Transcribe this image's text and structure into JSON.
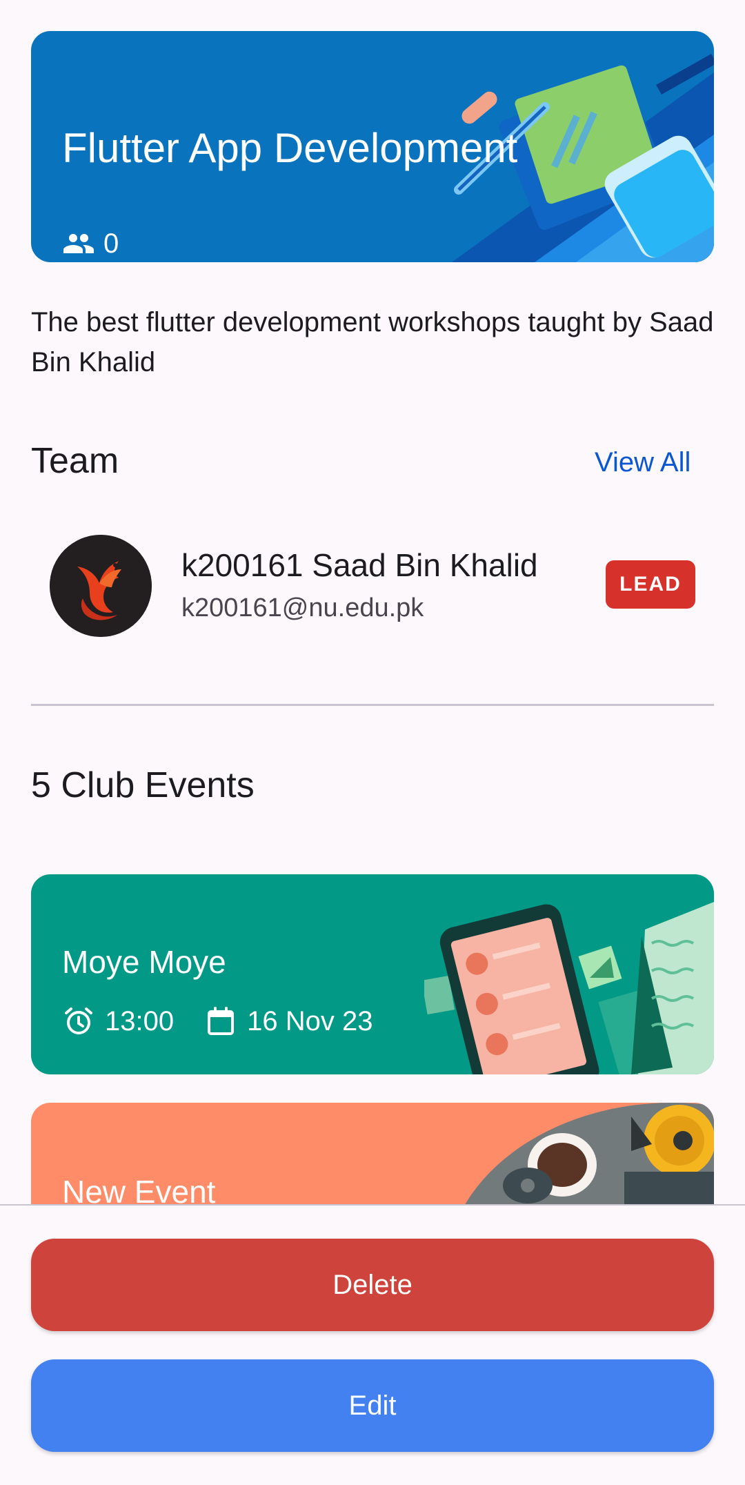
{
  "club": {
    "title": "Flutter App Development",
    "member_count": "0",
    "members_icon": "group-icon",
    "description": "The best flutter development workshops taught by Saad Bin Khalid"
  },
  "team": {
    "heading": "Team",
    "view_all_label": "View All",
    "members": [
      {
        "name": "k200161 Saad Bin Khalid",
        "email": "k200161@nu.edu.pk",
        "role_badge": "LEAD",
        "avatar_icon": "phoenix-logo-icon"
      }
    ]
  },
  "events": {
    "heading": "5 Club Events",
    "items": [
      {
        "title": "Moye Moye",
        "time": "13:00",
        "date": "16 Nov 23",
        "time_icon": "alarm-clock-icon",
        "date_icon": "calendar-icon",
        "color": "#029a86"
      },
      {
        "title": "New Event",
        "color": "#fe8c68"
      }
    ]
  },
  "actions": {
    "delete_label": "Delete",
    "edit_label": "Edit"
  },
  "colors": {
    "hero_blue": "#0a73bd",
    "lead_badge": "#d6322b",
    "delete_button": "#cf433d",
    "edit_button": "#4281ef",
    "link": "#0b57d0",
    "background": "#fdf8fc"
  }
}
